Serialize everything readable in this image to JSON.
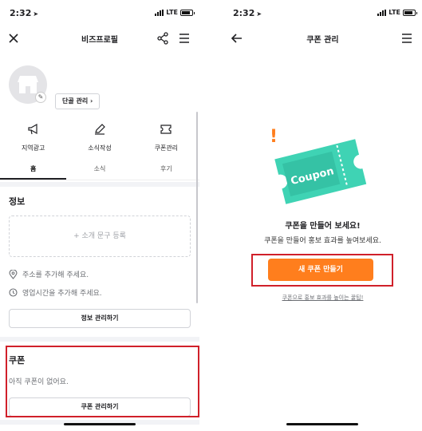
{
  "left": {
    "status": {
      "time": "2:32",
      "network": "LTE"
    },
    "nav": {
      "title": "비즈프로필"
    },
    "profile": {
      "regular_button": "단골 관리"
    },
    "actions": [
      {
        "label": "지역광고",
        "icon": "megaphone-icon"
      },
      {
        "label": "소식작성",
        "icon": "pencil-icon"
      },
      {
        "label": "쿠폰관리",
        "icon": "ticket-icon"
      }
    ],
    "tabs": [
      {
        "label": "홈",
        "active": true
      },
      {
        "label": "소식",
        "active": false
      },
      {
        "label": "후기",
        "active": false
      }
    ],
    "info": {
      "title": "정보",
      "intro_placeholder": "+ 소개 문구 등록",
      "address_hint": "주소를 추가해 주세요.",
      "hours_hint": "영업시간을 추가해 주세요.",
      "manage_button": "정보 관리하기"
    },
    "coupon": {
      "title": "쿠폰",
      "empty_text": "아직 쿠폰이 없어요.",
      "manage_button": "쿠폰 관리하기"
    }
  },
  "right": {
    "status": {
      "time": "2:32",
      "network": "LTE"
    },
    "nav": {
      "title": "쿠폰 관리"
    },
    "illustration_text": "Coupon",
    "headline": "쿠폰을 만들어 보세요!",
    "subline": "쿠폰을 만들어 홍보 효과를 높여보세요.",
    "create_button": "새 쿠폰 만들기",
    "tips_link": "쿠폰으로 홍보 효과를 높이는 꿀팁!"
  },
  "colors": {
    "accent": "#ff7e1d",
    "highlight": "#d0202a",
    "coupon": "#3fd3b4"
  }
}
